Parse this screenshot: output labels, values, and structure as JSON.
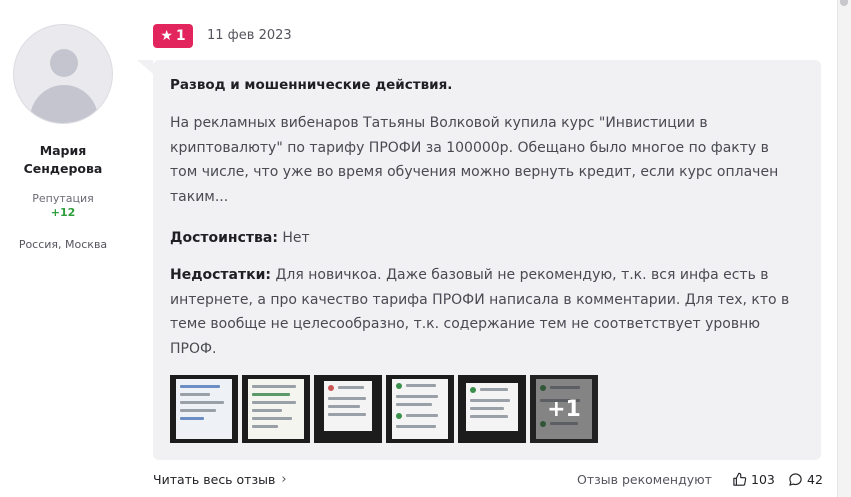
{
  "author": {
    "name_line1": "Мария",
    "name_line2": "Сендерова",
    "reputation_label": "Репутация",
    "reputation_value": "+12",
    "location": "Россия, Москва"
  },
  "review": {
    "rating": "1",
    "date": "11 фев 2023",
    "title": "Развод и мошеннические действия.",
    "body": "На рекламных вибенаров Татьяны Волковой купила курс \"Инвистиции в криптовалюту\" по тарифу ПРОФИ за 100000р. Обещано было многое по факту в том числе, что уже во время обучения можно вернуть кредит, если курс оплачен таким...",
    "pros_label": "Достоинства:",
    "pros_text": "Нет",
    "cons_label": "Недостатки:",
    "cons_text": "Для новичкоа. Даже базовый не рекомендую, т.к. вся инфа есть в интернете, а про качество тарифа ПРОФИ написала в комментарии. Для тех, кто в теме вообще не целесообразно, т.к. содержание тем не соответствует уровню ПРОФ.",
    "more_photos": "+1"
  },
  "footer": {
    "read_more": "Читать весь отзыв",
    "recommend_label": "Отзыв рекомендуют",
    "likes": "103",
    "comments": "42"
  },
  "colors": {
    "rating_badge": "#e2255c",
    "reputation_positive": "#2e9e3a",
    "card_background": "#f1f1f4"
  },
  "icons": {
    "rating": "star-icon",
    "read_more": "chevron-right-icon",
    "likes": "thumbs-up-icon",
    "comments": "comment-icon"
  }
}
